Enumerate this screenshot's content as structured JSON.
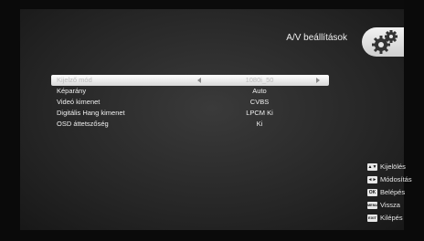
{
  "header": {
    "title": "A/V beállítások"
  },
  "menu": {
    "items": [
      {
        "label": "Kijelző mód",
        "value": "1080i_50",
        "selected": true
      },
      {
        "label": "Képarány",
        "value": "Auto",
        "selected": false
      },
      {
        "label": "Videó kimenet",
        "value": "CVBS",
        "selected": false
      },
      {
        "label": "Digitális Hang kimenet",
        "value": "LPCM Ki",
        "selected": false
      },
      {
        "label": "OSD áttetszőség",
        "value": "Ki",
        "selected": false
      }
    ]
  },
  "help": {
    "items": [
      {
        "key": "▲▼",
        "label": "Kijelölés"
      },
      {
        "key": "◄►",
        "label": "Módosítás"
      },
      {
        "key": "OK",
        "label": "Belépés"
      },
      {
        "key": "MENU",
        "label": "Vissza"
      },
      {
        "key": "EXIT",
        "label": "Kilépés"
      }
    ]
  }
}
